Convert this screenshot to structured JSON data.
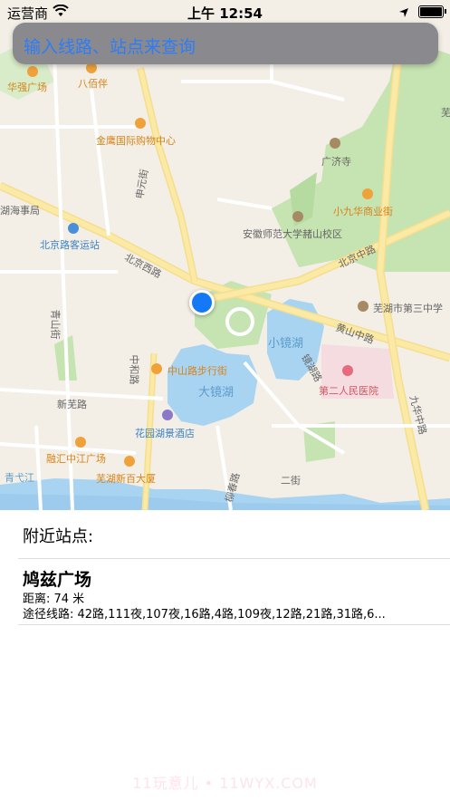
{
  "status_bar": {
    "carrier": "运营商",
    "time": "上午 12:54"
  },
  "search": {
    "placeholder": "输入线路、站点来查询"
  },
  "map": {
    "labels": {
      "huaqiang": "华强广场",
      "babaiban": "八佰伴",
      "jinying": "金鹰国际购物中心",
      "guangji": "广济寺",
      "hushiju": "湖海事局",
      "beijinglu_kyz": "北京路客运站",
      "xiaojiuhua": "小九华商业街",
      "anhui_normal": "安徽师范大学赭山校区",
      "beijingzhonglu": "北京中路",
      "beijingxilu": "北京西路",
      "wuhu_third": "芜湖市第三中学",
      "huangshanlu": "黄山中路",
      "xiaojinghu": "小镜湖",
      "zhongshanlu": "中山路步行街",
      "dajinghu": "大镜湖",
      "second_hospital": "第二人民医院",
      "jiuhuazhonglu": "九华中路",
      "qingshanjie": "青山街",
      "xinwulu": "新芜路",
      "huayuanhu": "花园湖景酒店",
      "ronghui": "融汇中江广场",
      "wuhuxinbai": "芜湖新百大厦",
      "qingyijiang": "青弋江",
      "zhonghelu": "中和路",
      "shenyuanjie": "申元街",
      "zhenhulu": "镜湖路",
      "liuchunlu": "柳春路",
      "erjie": "二街",
      "edge_right": "芜"
    }
  },
  "nearby": {
    "title": "附近站点:",
    "stations": [
      {
        "name": "鸠兹广场",
        "distance": "距离: 74 米",
        "lines": "途径线路: 42路,111夜,107夜,16路,4路,109夜,12路,21路,31路,6..."
      }
    ]
  },
  "watermark": "11玩意儿 • 11WYX.COM",
  "colors": {
    "accent": "#2e7cf6",
    "user_location": "#1479f6",
    "search_bg": "#8a8a8e",
    "water": "#a8d4f2",
    "park": "#c6e3b2"
  },
  "icons": [
    "wifi-icon",
    "location-arrow-icon",
    "battery-icon",
    "shopping-icon",
    "bus-station-icon",
    "temple-icon",
    "school-icon",
    "hospital-icon",
    "hotel-icon"
  ]
}
